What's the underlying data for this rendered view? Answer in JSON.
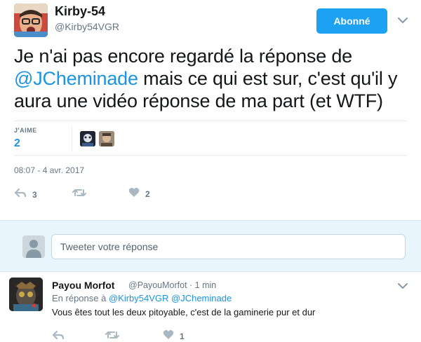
{
  "main_tweet": {
    "author_name": "Kirby-54",
    "author_handle": "@Kirby54VGR",
    "follow_label": "Abonné",
    "text_part1": "Je n'ai pas encore regardé la réponse de ",
    "mention": "@JCheminade",
    "text_part2": " mais ce qui est sur, c'est qu'il y aura une vidéo réponse de ma part (et WTF)",
    "likes_label": "J'AIME",
    "likes_count": "2",
    "timestamp": "08:07 - 4 avr. 2017",
    "reply_count": "3",
    "retweet_count": "",
    "like_count": "2"
  },
  "reply_box": {
    "placeholder": "Tweeter votre réponse"
  },
  "reply_tweet": {
    "author_name": "Payou Morfot",
    "author_handle": "@PayouMorfot · 1 min",
    "in_reply_prefix": "En réponse à ",
    "in_reply_mentions": "@Kirby54VGR @JCheminade",
    "text": "Vous êtes tout les deux pitoyable, c'est de la gaminerie pur et dur",
    "reply_count": "",
    "retweet_count": "",
    "like_count": "1"
  },
  "colors": {
    "accent": "#1da1f2",
    "link": "#1b95e0",
    "muted": "#657786",
    "reply_bg": "#e8f5fd"
  },
  "icons": {
    "reply": "reply-icon",
    "retweet": "retweet-icon",
    "like": "heart-icon",
    "menu": "chevron-down-icon"
  }
}
